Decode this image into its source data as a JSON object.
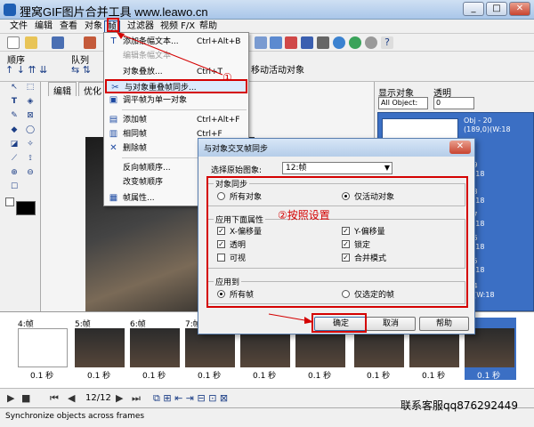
{
  "window": {
    "title": "狸窝GIF图片合并工具 www.leawo.cn"
  },
  "menubar": [
    "文件",
    "编辑",
    "查看",
    "对象",
    "帧",
    "过滤器",
    "视频 F/X",
    "帮助"
  ],
  "toolbar_row3": {
    "order_label": "顺序",
    "queue_label": "队列",
    "move_active": "移动活动对象"
  },
  "tabs": [
    "编辑",
    "优化"
  ],
  "right_panel": {
    "show_objects_label": "显示对象",
    "transparency_label": "透明",
    "objects_select": "All Object:",
    "transparency_value": "0",
    "objects": [
      "Obj - 20\n(189,0)(W:18",
      "- 19\n(W:18",
      "- 18\n(W:18",
      "- 17\n(W:18",
      "- 16\n(W:18",
      "- 15\n(W:18",
      "- 14\n-1)(W:18"
    ]
  },
  "frame_menu": {
    "items": [
      {
        "label": "添加条幅文本...",
        "shortcut": "Ctrl+Alt+B",
        "icon": "text-icon",
        "disabled": false
      },
      {
        "label": "编辑条幅文本",
        "shortcut": "",
        "icon": "",
        "disabled": true
      },
      {
        "label": "对象叠放...",
        "shortcut": "Ctrl+T",
        "icon": "",
        "disabled": false
      },
      {
        "label": "与对象重叠帧同步...",
        "shortcut": "",
        "icon": "sync-icon",
        "disabled": false
      },
      {
        "label": "调平帧为单一对象",
        "shortcut": "",
        "icon": "flatten-icon",
        "disabled": false
      },
      {
        "label": "添加帧",
        "shortcut": "Ctrl+Alt+F",
        "icon": "add-frame-icon",
        "disabled": false
      },
      {
        "label": "相同帧",
        "shortcut": "Ctrl+F",
        "icon": "duplicate-icon",
        "disabled": false
      },
      {
        "label": "删除帧",
        "shortcut": "",
        "icon": "delete-icon",
        "disabled": false
      },
      {
        "label": "反向帧顺序...",
        "shortcut": "",
        "icon": "",
        "disabled": false
      },
      {
        "label": "改变帧顺序",
        "shortcut": "",
        "icon": "",
        "disabled": false
      },
      {
        "label": "帧属性...",
        "shortcut": "",
        "icon": "properties-icon",
        "disabled": false
      }
    ]
  },
  "annotations": {
    "step1": "①",
    "step2": "②按照设置"
  },
  "dialog": {
    "title": "与对象交叉帧同步",
    "source_label": "选择原始图象:",
    "source_value": "12:帧",
    "object_sync": {
      "label": "对象同步",
      "all": "所有对象",
      "active": "仅活动对象"
    },
    "apply_props": {
      "label": "应用下面属性",
      "x_move": "X-偏移量",
      "y_move": "Y-偏移量",
      "transparent": "透明",
      "locked": "锁定",
      "visible": "可视",
      "merge": "合并模式"
    },
    "apply_to": {
      "label": "应用到",
      "all_frames": "所有帧",
      "selected_frames": "仅选定的帧"
    },
    "buttons": {
      "ok": "确定",
      "cancel": "取消",
      "help": "帮助"
    }
  },
  "frames": [
    {
      "label": "4:帧",
      "time": "0.1 秒"
    },
    {
      "label": "5:帧",
      "time": "0.1 秒"
    },
    {
      "label": "6:帧",
      "time": "0.1 秒"
    },
    {
      "label": "7:帧",
      "time": "0.1 秒"
    },
    {
      "label": "",
      "time": "0.1 秒"
    },
    {
      "label": "",
      "time": "0.1 秒"
    },
    {
      "label": "",
      "time": "0.1 秒"
    },
    {
      "label": "",
      "time": "0.1 秒"
    },
    {
      "label": "",
      "time": "0.1 秒"
    }
  ],
  "playbar": {
    "counter": "12/12"
  },
  "status": {
    "text": "Synchronize objects across frames",
    "service": "联系客服qq876292449"
  },
  "colors": {
    "highlight_red": "#d40000",
    "selection_blue": "#3b6fc4"
  }
}
